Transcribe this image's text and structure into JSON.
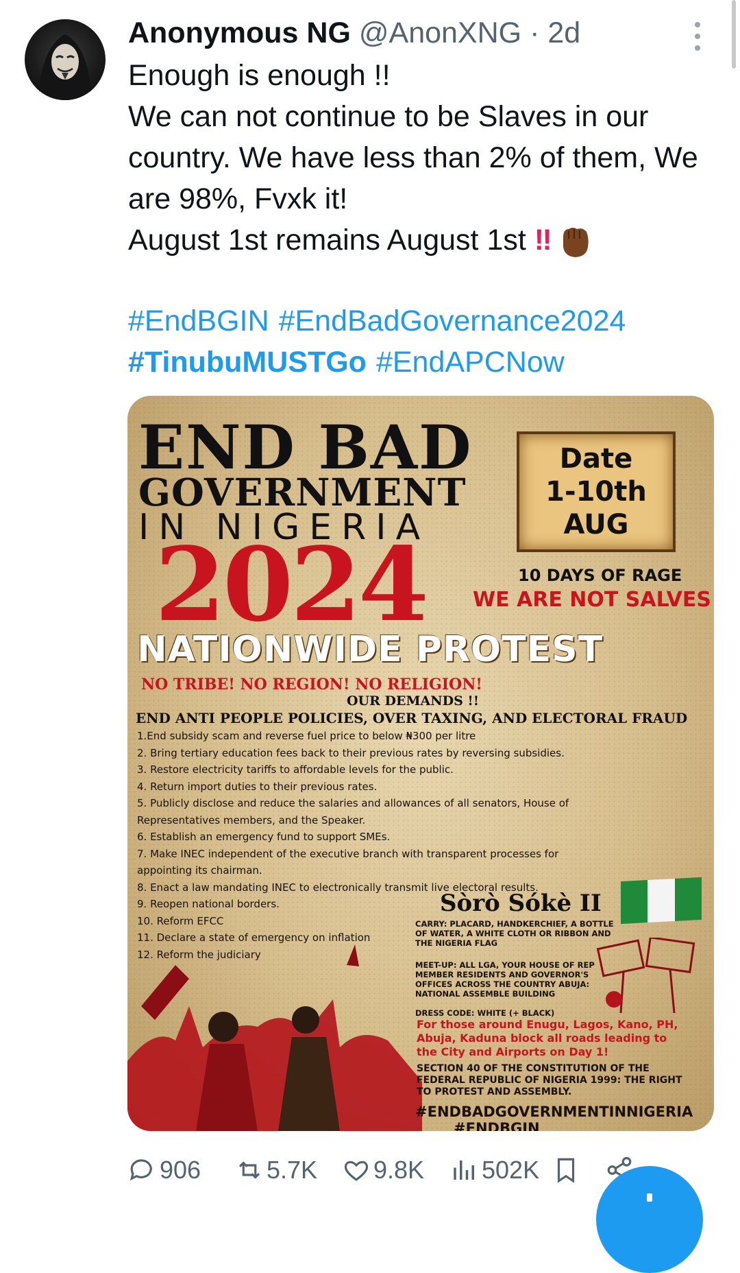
{
  "tweet": {
    "display_name": "Anonymous NG",
    "handle": "@AnonXNG",
    "separator": "·",
    "time": "2d",
    "lines": [
      "Enough is enough !!",
      "We can not continue to be Slaves in our country. We have less than 2% of them, We are 98%, Fvxk it!",
      "August 1st remains August 1st"
    ],
    "emoji_bang": "‼",
    "hashtags": [
      "#EndBGIN",
      "#EndBadGovernance2024",
      "#TinubuMUSTGo",
      "#EndAPCNow"
    ],
    "bold_hashtag_index": 2
  },
  "poster": {
    "title_line1": "END BAD",
    "title_line2": "GOVERNMENT",
    "title_line3": "IN NIGERIA",
    "year": "2024",
    "date_lines": [
      "Date",
      "1-10th",
      "AUG"
    ],
    "rage": "10 DAYS OF RAGE",
    "not_salves": "WE ARE NOT SALVES",
    "nationwide": "NATIONWIDE  PROTEST",
    "tribe": "NO TRIBE! NO REGION! NO RELIGION!",
    "our_demands": "OUR DEMANDS !!",
    "end_anti": "END ANTI PEOPLE POLICIES, OVER TAXING, AND ELECTORAL FRAUD",
    "demands": [
      "1.End subsidy scam and reverse fuel price to below ₦300 per litre",
      "2. Bring tertiary education fees back to their previous rates by reversing subsidies.",
      "3. Restore electricity tariffs to affordable levels for the public.",
      "4. Return import duties to their previous rates.",
      "5. Publicly disclose and reduce the salaries and allowances of all senators, House of",
      "Representatives members, and the Speaker.",
      "6. Establish an emergency fund to support SMEs.",
      "7. Make INEC independent of the executive branch with transparent processes for",
      "appointing its chairman.",
      "8. Enact a law mandating INEC to electronically transmit live electoral results.",
      "9. Reopen national borders.",
      "10. Reform EFCC",
      "11. Declare a state of emergency on inflation",
      "12. Reform the judiciary"
    ],
    "soro": "Sòrò Sókè II",
    "carry": "CARRY: PLACARD, HANDKERCHIEF, A BOTTLE OF WATER, A WHITE CLOTH OR RIBBON AND THE NIGERIA FLAG",
    "meetup": "MEET-UP: ALL LGA, YOUR HOUSE OF REP MEMBER RESIDENTS AND GOVERNOR'S OFFICES ACROSS THE COUNTRY ABUJA: NATIONAL ASSEMBLE BUILDING",
    "dress": "DRESS CODE: WHITE (+ BLACK)",
    "red_text": "For those around Enugu, Lagos, Kano, PH, Abuja, Kaduna block all roads leading to the City and Airports on Day 1!",
    "section": "SECTION 40 OF THE CONSTITUTION OF THE FEDERAL REPUBLIC OF NIGERIA 1999: THE RIGHT TO PROTEST AND ASSEMBLY.",
    "tag1": "#ENDBADGOVERNMENTINNIGERIA",
    "tag2": "#ENDBGIN",
    "colors": {
      "red": "#c8141e",
      "flag_green": "#1e8a3a",
      "paper": "#d6bd8c"
    }
  },
  "actions": {
    "replies": "906",
    "reposts": "5.7K",
    "likes": "9.8K",
    "views": "502K"
  },
  "icons": [
    "avatar",
    "more-icon",
    "fist-emoji-icon",
    "reply-icon",
    "repost-icon",
    "like-icon",
    "views-icon",
    "bookmark-icon",
    "share-icon",
    "compose-fab"
  ],
  "colors": {
    "link": "#1d9bf0",
    "muted": "#536471",
    "text": "#0f1419"
  }
}
